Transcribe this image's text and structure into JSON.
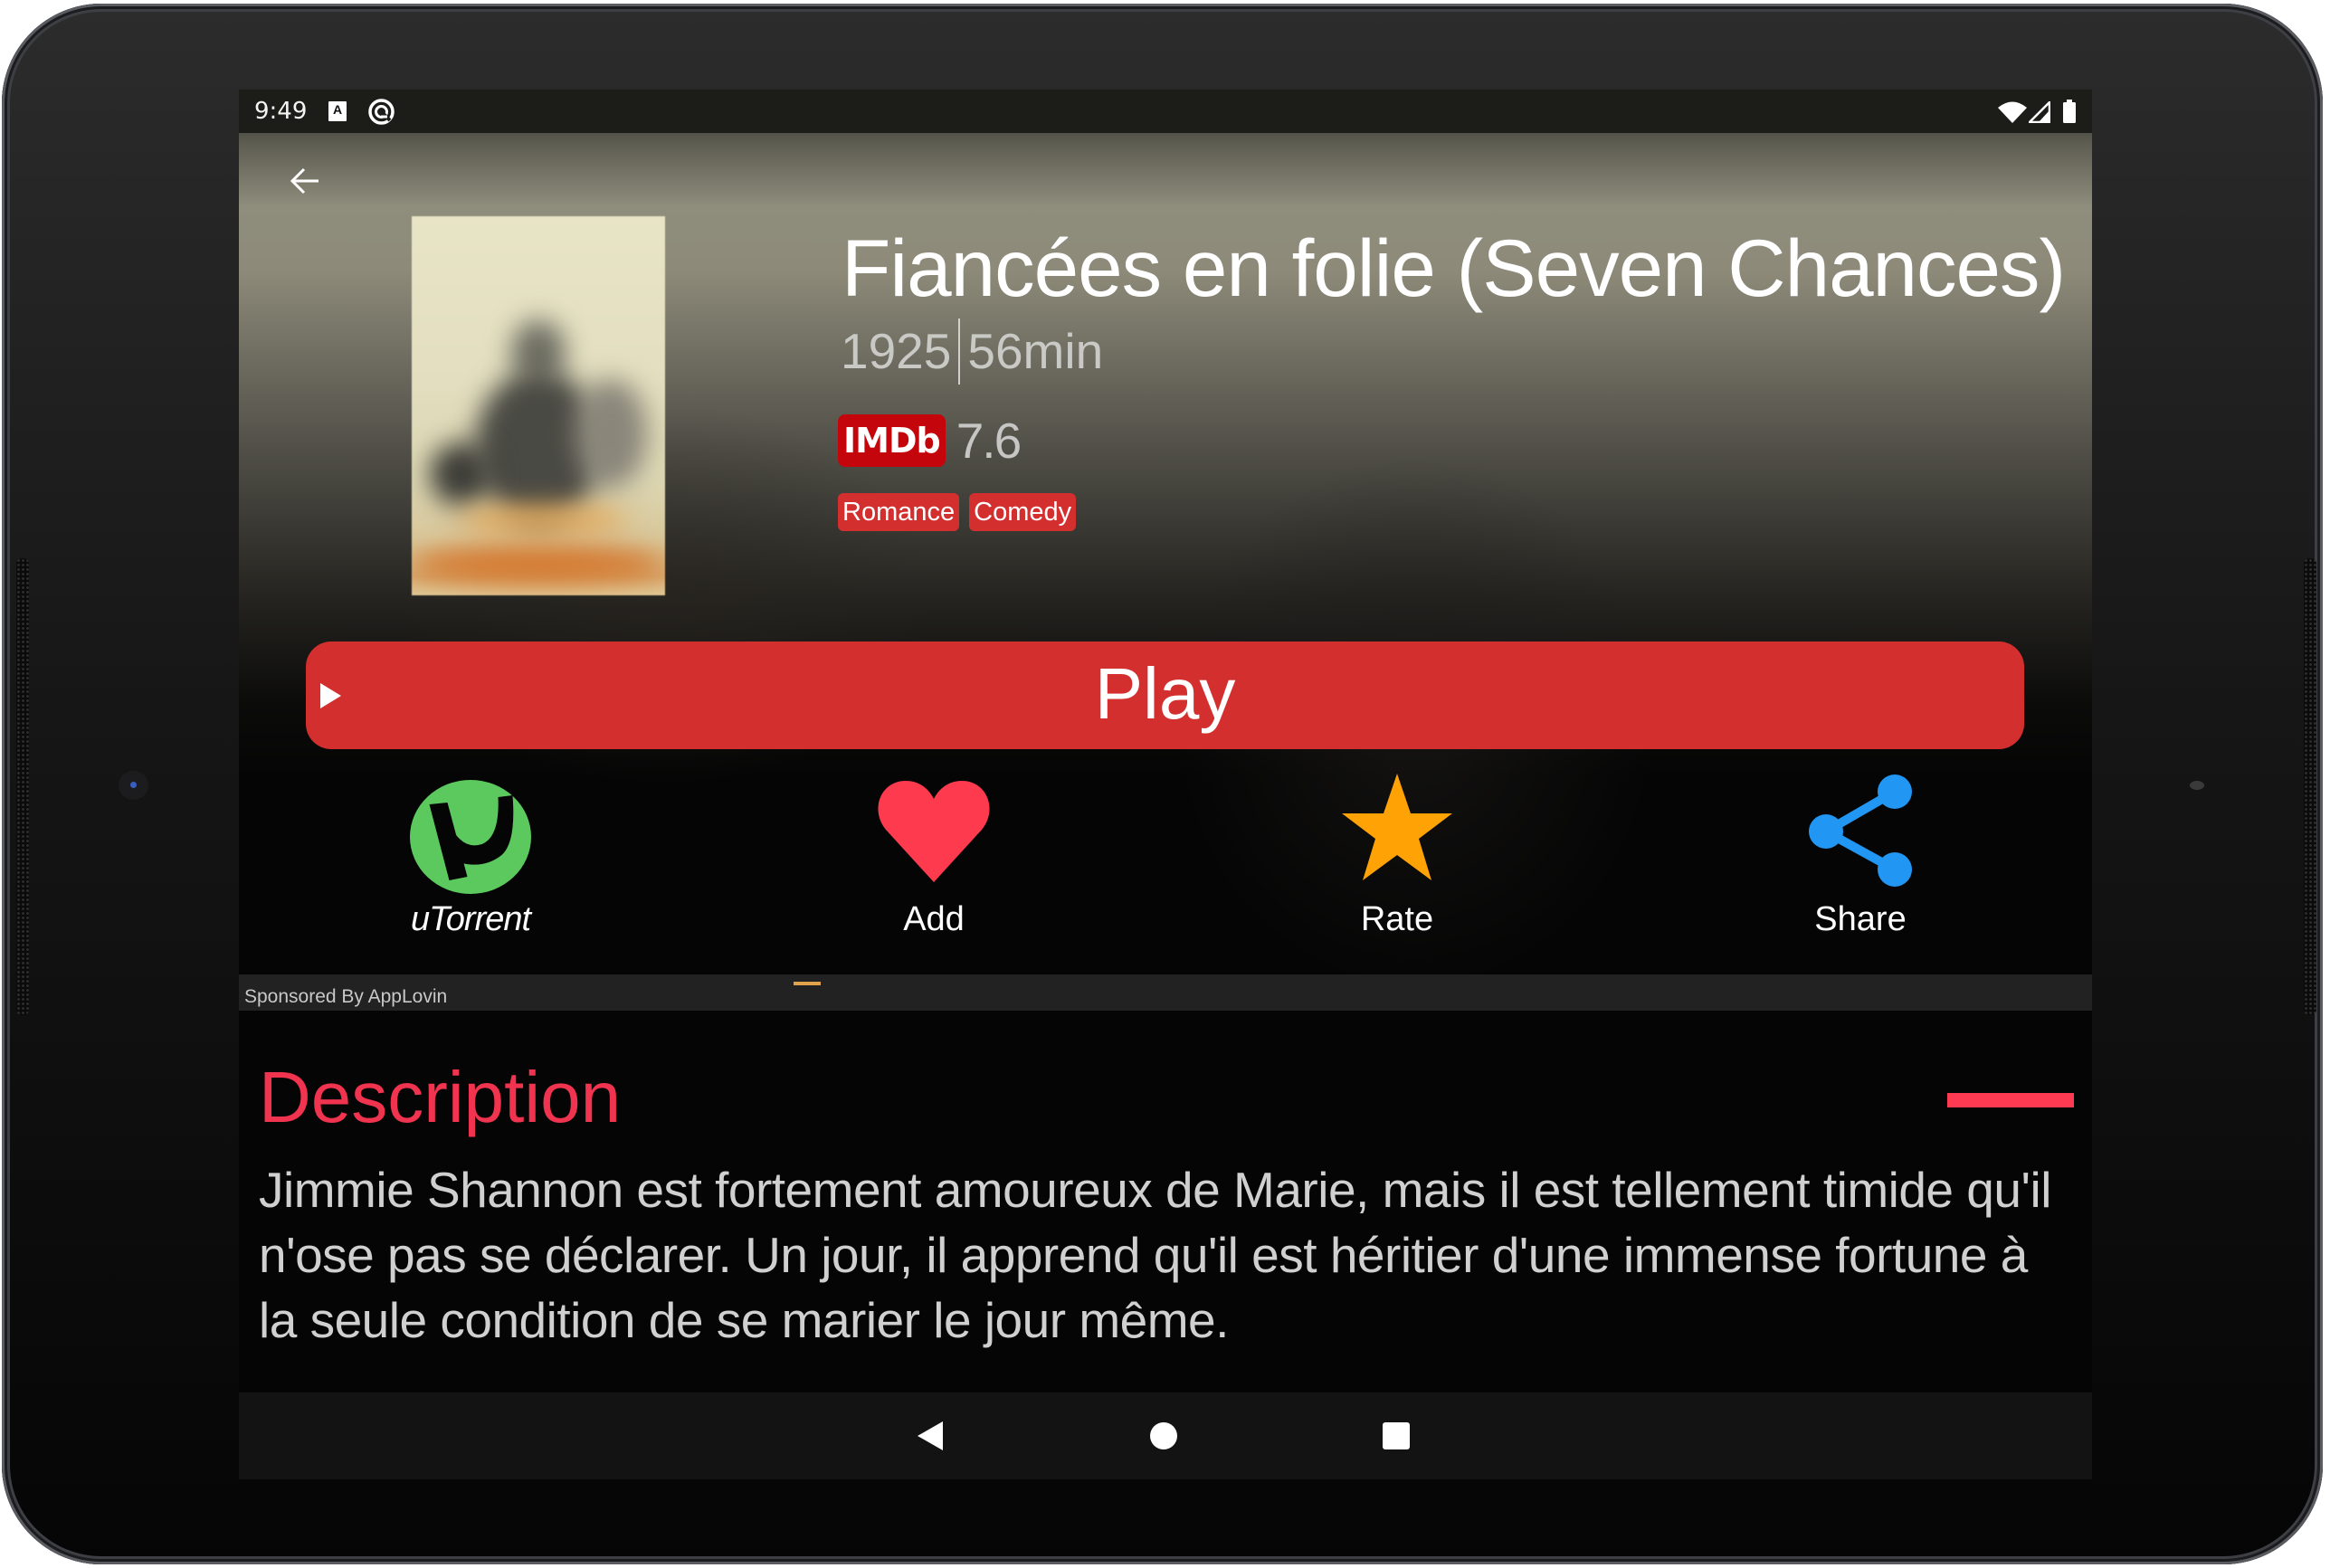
{
  "status_bar": {
    "time": "9:49",
    "icons": [
      "keyboard-a-icon",
      "data-saver-icon",
      "wifi-icon",
      "cellular-signal-icon",
      "battery-icon"
    ]
  },
  "header": {
    "back_icon": "arrow-left-icon"
  },
  "movie": {
    "title": "Fiancées en folie (Seven Chances)",
    "year": "1925",
    "duration": "56min",
    "rating_source": "IMDb",
    "rating": "7.6",
    "genres": [
      "Romance",
      "Comedy"
    ]
  },
  "play_button": {
    "label": "Play",
    "icon": "play-triangle-icon"
  },
  "actions": [
    {
      "label": "uTorrent",
      "icon": "utorrent-icon",
      "color": "#5cc95f"
    },
    {
      "label": "Add",
      "icon": "heart-icon",
      "color": "#fe3a4e"
    },
    {
      "label": "Rate",
      "icon": "star-icon",
      "color": "#ffa206"
    },
    {
      "label": "Share",
      "icon": "share-icon",
      "color": "#2196f3"
    }
  ],
  "ad": {
    "sponsor_label": "Sponsored By AppLovin"
  },
  "description": {
    "heading": "Description",
    "text": "Jimmie Shannon est fortement amoureux de Marie, mais il est tellement timide qu'il n'ose pas se déclarer. Un jour, il apprend qu'il est héritier d'une immense fortune à la seule condition de se marier le jour même."
  },
  "nav_bar": {
    "buttons": [
      "back-icon",
      "home-icon",
      "recents-icon"
    ]
  },
  "colors": {
    "accent_red": "#d32f2f",
    "heading_red": "#f0334f",
    "imdb_red": "#c4050b"
  }
}
